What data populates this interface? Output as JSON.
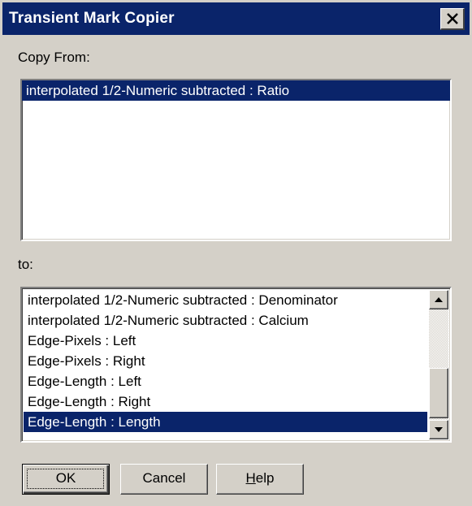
{
  "window": {
    "title": "Transient Mark Copier"
  },
  "copy_from": {
    "label": "Copy From:",
    "items": [
      "interpolated 1/2-Numeric subtracted : Ratio"
    ],
    "selected_index": 0
  },
  "copy_to": {
    "label": "to:",
    "items": [
      "interpolated 1/2-Numeric subtracted : Denominator",
      "interpolated 1/2-Numeric subtracted : Calcium",
      "Edge-Pixels : Left",
      "Edge-Pixels : Right",
      "Edge-Length : Left",
      "Edge-Length : Right",
      "Edge-Length : Length"
    ],
    "selected_index": 6
  },
  "buttons": {
    "ok": "OK",
    "cancel": "Cancel",
    "help_mnemonic": "H",
    "help_rest": "elp"
  },
  "icons": {
    "close": "close-icon",
    "scroll_up": "arrow-up-icon",
    "scroll_down": "arrow-down-icon"
  },
  "colors": {
    "titlebar": "#0a246a",
    "selection": "#0a246a",
    "face": "#d4d0c8"
  }
}
